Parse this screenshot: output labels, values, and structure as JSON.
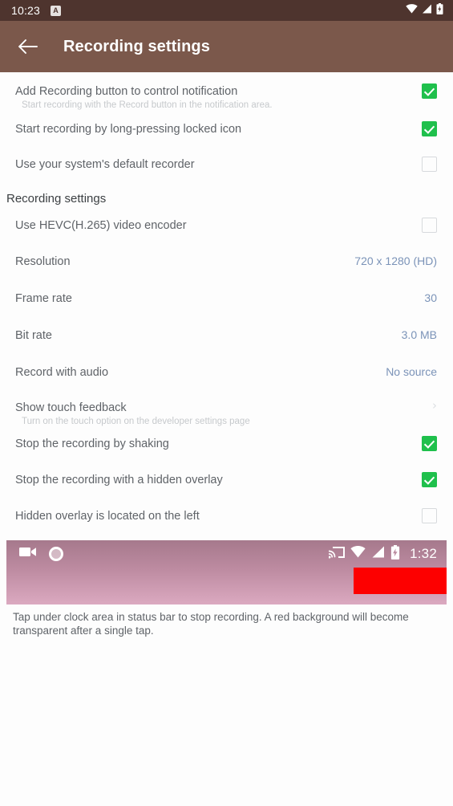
{
  "status_bar": {
    "clock": "10:23",
    "app_badge_letter": "A",
    "icons": [
      "wifi-icon",
      "signal-icon",
      "battery-charging-icon"
    ],
    "background_color": "#4e342e"
  },
  "app_bar": {
    "back_icon": "back-arrow-icon",
    "title": "Recording settings",
    "background_color": "#7b584b"
  },
  "colors": {
    "checkbox_on": "#1fc04c",
    "checkbox_off_border": "#d7dadd",
    "value_text": "#7b93b8",
    "red_block": "#fd0000"
  },
  "top_settings": [
    {
      "title": "Add Recording button to control notification",
      "subtitle": "Start recording with the Record button in the notification area.",
      "control": "checkbox",
      "checked": true
    },
    {
      "title": "Start recording by long-pressing locked icon",
      "subtitle": "",
      "control": "checkbox",
      "checked": true
    },
    {
      "title": "Use your system's default recorder",
      "subtitle": "",
      "control": "checkbox",
      "checked": false
    }
  ],
  "section": {
    "header": "Recording settings",
    "items": [
      {
        "title": "Use HEVC(H.265) video encoder",
        "subtitle": "",
        "control": "checkbox",
        "checked": false,
        "value": ""
      },
      {
        "title": "Resolution",
        "subtitle": "",
        "control": "value",
        "checked": false,
        "value": "720 x 1280 (HD)"
      },
      {
        "title": "Frame rate",
        "subtitle": "",
        "control": "value",
        "checked": false,
        "value": "30"
      },
      {
        "title": "Bit rate",
        "subtitle": "",
        "control": "value",
        "checked": false,
        "value": "3.0 MB"
      },
      {
        "title": "Record with audio",
        "subtitle": "",
        "control": "value",
        "checked": false,
        "value": "No source"
      },
      {
        "title": "Show touch feedback",
        "subtitle": "Turn on the touch option on the developer settings page",
        "control": "chevron",
        "checked": false,
        "value": "›"
      },
      {
        "title": "Stop the recording by shaking",
        "subtitle": "",
        "control": "checkbox",
        "checked": true,
        "value": ""
      },
      {
        "title": "Stop the recording with a hidden overlay",
        "subtitle": "",
        "control": "checkbox",
        "checked": true,
        "value": ""
      },
      {
        "title": "Hidden overlay is located on the left",
        "subtitle": "",
        "control": "checkbox",
        "checked": false,
        "value": ""
      }
    ]
  },
  "illustration": {
    "left_icons": [
      "video-camera-icon",
      "record-circle-icon"
    ],
    "right_icons": [
      "cast-icon",
      "wifi-icon",
      "signal-icon",
      "battery-charging-icon"
    ],
    "time": "1:32",
    "caption": "Tap under clock area in status bar to stop recording. A red background will become transparent after a single tap."
  }
}
